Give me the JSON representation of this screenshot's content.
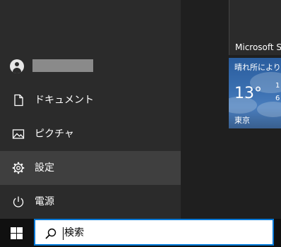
{
  "user": {
    "name": ""
  },
  "menu": {
    "items": [
      {
        "label": "ドキュメント",
        "icon": "document-icon"
      },
      {
        "label": "ピクチャ",
        "icon": "pictures-icon"
      },
      {
        "label": "設定",
        "icon": "gear-icon",
        "selected": true
      },
      {
        "label": "電源",
        "icon": "power-icon"
      }
    ]
  },
  "tiles": {
    "store": {
      "label": "Microsoft Sto"
    },
    "weather": {
      "title": "晴れ所により曇",
      "temp": "13°",
      "high": "1",
      "low": "6",
      "city": "東京"
    }
  },
  "taskbar": {
    "search": {
      "text": "検索",
      "icon": "search-icon"
    },
    "start_icon": "windows-logo-icon"
  },
  "colors": {
    "start_panel": "#2b2b2b",
    "selected_item": "#3f3f3f",
    "taskbar": "#101010",
    "search_border": "#0078d7",
    "weather_tile": "#3a6fb0"
  }
}
